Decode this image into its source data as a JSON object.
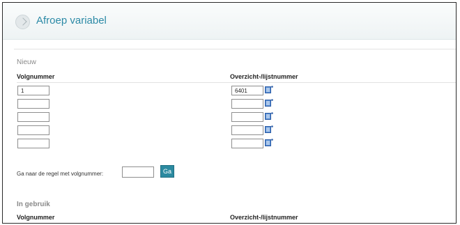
{
  "header": {
    "title": "Afroep variabel"
  },
  "nieuw": {
    "section_label": "Nieuw",
    "col_volgnummer": "Volgnummer",
    "col_overzicht": "Overzicht-/lijstnummer",
    "rows": [
      {
        "volgnummer": "1",
        "overzicht": "6401"
      },
      {
        "volgnummer": "",
        "overzicht": ""
      },
      {
        "volgnummer": "",
        "overzicht": ""
      },
      {
        "volgnummer": "",
        "overzicht": ""
      },
      {
        "volgnummer": "",
        "overzicht": ""
      }
    ]
  },
  "goto": {
    "label": "Ga naar de regel met volgnummer:",
    "value": "",
    "button_label": "Ga"
  },
  "in_gebruik": {
    "section_label": "In gebruik",
    "col_volgnummer": "Volgnummer",
    "col_overzicht": "Overzicht-/lijstnummer"
  },
  "icons": {
    "header": "circle-arrow-icon",
    "row_picker": "list-picker-icon"
  },
  "colors": {
    "accent": "#2c8aa6",
    "button": "#2c8aa0"
  }
}
